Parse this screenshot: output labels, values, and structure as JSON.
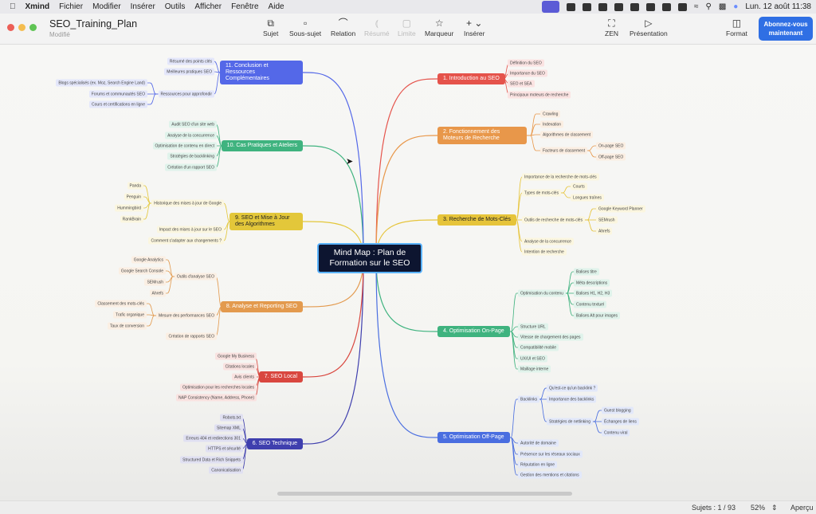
{
  "menubar": {
    "app": "Xmind",
    "items": [
      "Fichier",
      "Modifier",
      "Insérer",
      "Outils",
      "Afficher",
      "Fenêtre",
      "Aide"
    ],
    "clock": "Lun. 12 août 11:38"
  },
  "toolbar": {
    "title": "SEO_Training_Plan",
    "status": "Modifié",
    "buttons": [
      {
        "label": "Sujet",
        "icon": "topic-icon",
        "enabled": true
      },
      {
        "label": "Sous-sujet",
        "icon": "subtopic-icon",
        "enabled": true
      },
      {
        "label": "Relation",
        "icon": "relation-icon",
        "enabled": true
      },
      {
        "label": "Résumé",
        "icon": "summary-icon",
        "enabled": false
      },
      {
        "label": "Limite",
        "icon": "boundary-icon",
        "enabled": false
      },
      {
        "label": "Marqueur",
        "icon": "marker-icon",
        "enabled": true
      },
      {
        "label": "Insérer",
        "icon": "plus-icon",
        "enabled": true
      }
    ],
    "zen": "ZEN",
    "presentation": "Présentation",
    "format": "Format",
    "subscribe": "Abonnez-vous maintenant"
  },
  "map": {
    "center": "Mind Map : Plan de Formation sur le SEO",
    "branches": [
      {
        "label": "1. Introduction au SEO",
        "color": "#e5534b",
        "children": [
          {
            "label": "Définition du SEO"
          },
          {
            "label": "Importance du SEO"
          },
          {
            "label": "SEO et SEA"
          },
          {
            "label": "Principaux moteurs de recherche"
          }
        ]
      },
      {
        "label": "2. Fonctionnement des Moteurs de Recherche",
        "color": "#e8974a",
        "children": [
          {
            "label": "Crawling"
          },
          {
            "label": "Indexation"
          },
          {
            "label": "Algorithmes de classement"
          },
          {
            "label": "Facteurs de classement",
            "children": [
              {
                "label": "On-page SEO"
              },
              {
                "label": "Off-page SEO"
              }
            ]
          }
        ]
      },
      {
        "label": "3. Recherche de Mots-Clés",
        "color": "#e6c43a",
        "children": [
          {
            "label": "Importance de la recherche de mots-clés"
          },
          {
            "label": "Types de mots-clés",
            "children": [
              {
                "label": "Courts"
              },
              {
                "label": "Longues traînes"
              }
            ]
          },
          {
            "label": "Outils de recherche de mots-clés",
            "children": [
              {
                "label": "Google Keyword Planner"
              },
              {
                "label": "SEMrush"
              },
              {
                "label": "Ahrefs"
              }
            ]
          },
          {
            "label": "Analyse de la concurrence"
          },
          {
            "label": "Intention de recherche"
          }
        ]
      },
      {
        "label": "4. Optimisation On-Page",
        "color": "#3fb37f",
        "children": [
          {
            "label": "Optimisation du contenu",
            "children": [
              {
                "label": "Balises titre"
              },
              {
                "label": "Méta descriptions"
              },
              {
                "label": "Balises H1, H2, H3"
              },
              {
                "label": "Contenu textuel"
              },
              {
                "label": "Balises Alt pour images"
              }
            ]
          },
          {
            "label": "Structure URL"
          },
          {
            "label": "Vitesse de chargement des pages"
          },
          {
            "label": "Compatibilité mobile"
          },
          {
            "label": "UX/UI et SEO"
          },
          {
            "label": "Maillage interne"
          }
        ]
      },
      {
        "label": "5. Optimisation Off-Page",
        "color": "#4a6ee0",
        "children": [
          {
            "label": "Backlinks",
            "children": [
              {
                "label": "Qu'est-ce qu'un backlink ?"
              },
              {
                "label": "Importance des backlinks"
              },
              {
                "label": "Stratégies de netlinking",
                "children": [
                  {
                    "label": "Guest blogging"
                  },
                  {
                    "label": "Échanges de liens"
                  },
                  {
                    "label": "Contenu viral"
                  }
                ]
              }
            ]
          },
          {
            "label": "Autorité de domaine"
          },
          {
            "label": "Présence sur les réseaux sociaux"
          },
          {
            "label": "Réputation en ligne"
          },
          {
            "label": "Gestion des mentions et citations"
          }
        ]
      },
      {
        "label": "6. SEO Technique",
        "color": "#3f3fae",
        "children": [
          {
            "label": "Robots.txt"
          },
          {
            "label": "Sitemap XML"
          },
          {
            "label": "Erreurs 404 et redirections 301"
          },
          {
            "label": "HTTPS et sécurité"
          },
          {
            "label": "Structured Data et Rich Snippets"
          },
          {
            "label": "Canonicalisation"
          }
        ]
      },
      {
        "label": "7. SEO Local",
        "color": "#d9473f",
        "children": [
          {
            "label": "Google My Business"
          },
          {
            "label": "Citations locales"
          },
          {
            "label": "Avis clients"
          },
          {
            "label": "Optimisation pour les recherches locales"
          },
          {
            "label": "NAP Consistency (Name, Address, Phone)"
          }
        ]
      },
      {
        "label": "8. Analyse et Reporting SEO",
        "color": "#e39a4e",
        "children": [
          {
            "label": "Outils d'analyse SEO",
            "children": [
              {
                "label": "Google Analytics"
              },
              {
                "label": "Google Search Console"
              },
              {
                "label": "SEMrush"
              },
              {
                "label": "Ahrefs"
              }
            ]
          },
          {
            "label": "Mesure des performances SEO",
            "children": [
              {
                "label": "Classement des mots-clés"
              },
              {
                "label": "Trafic organique"
              },
              {
                "label": "Taux de conversion"
              }
            ]
          },
          {
            "label": "Création de rapports SEO"
          }
        ]
      },
      {
        "label": "9. SEO et Mise à Jour des Algorithmes",
        "color": "#e3c73a",
        "children": [
          {
            "label": "Historique des mises à jour de Google",
            "children": [
              {
                "label": "Panda"
              },
              {
                "label": "Penguin"
              },
              {
                "label": "Hummingbird"
              },
              {
                "label": "RankBrain"
              }
            ]
          },
          {
            "label": "Impact des mises à jour sur le SEO"
          },
          {
            "label": "Comment s'adapter aux changements ?"
          }
        ]
      },
      {
        "label": "10. Cas Pratiques et Ateliers",
        "color": "#3fb37f",
        "children": [
          {
            "label": "Audit SEO d'un site web"
          },
          {
            "label": "Analyse de la concurrence"
          },
          {
            "label": "Optimisation de contenu en direct"
          },
          {
            "label": "Stratégies de backlinking"
          },
          {
            "label": "Création d'un rapport SEO"
          }
        ]
      },
      {
        "label": "11. Conclusion et Ressources Complémentaires",
        "color": "#5468e8",
        "children": [
          {
            "label": "Résumé des points clés"
          },
          {
            "label": "Meilleures pratiques SEO"
          },
          {
            "label": "Ressources pour approfondir",
            "children": [
              {
                "label": "Blogs spécialisés (ex. Moz, Search Engine Land)"
              },
              {
                "label": "Forums et communautés SEO"
              },
              {
                "label": "Cours et certifications en ligne"
              }
            ]
          }
        ]
      }
    ]
  },
  "statusbar": {
    "topics": "Sujets : 1 / 93",
    "zoom": "52%",
    "preview": "Aperçu"
  }
}
